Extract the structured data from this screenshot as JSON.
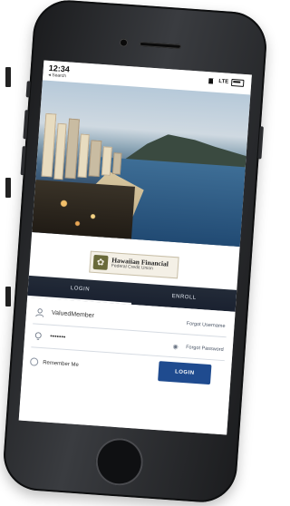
{
  "status_bar": {
    "time": "12:34",
    "back_label": "◂ Search",
    "network": "LTE"
  },
  "brand": {
    "name": "Hawaiian Financial",
    "subtitle": "Federal Credit Union"
  },
  "tabs": [
    {
      "label": "LOGIN",
      "active": true
    },
    {
      "label": "ENROLL",
      "active": false
    }
  ],
  "login_form": {
    "username_value": "ValuedMember",
    "forgot_username_label": "Forgot Username",
    "password_value": "•••••••",
    "forgot_password_label": "Forgot Password",
    "remember_me_label": "Remember Me",
    "login_button_label": "LOGIN"
  },
  "icons": {
    "username": "user-icon",
    "password": "lightbulb-icon",
    "show_password": "eye-icon"
  },
  "colors": {
    "login_button": "#1f4b8f",
    "tab_bar": "#1f2734"
  }
}
